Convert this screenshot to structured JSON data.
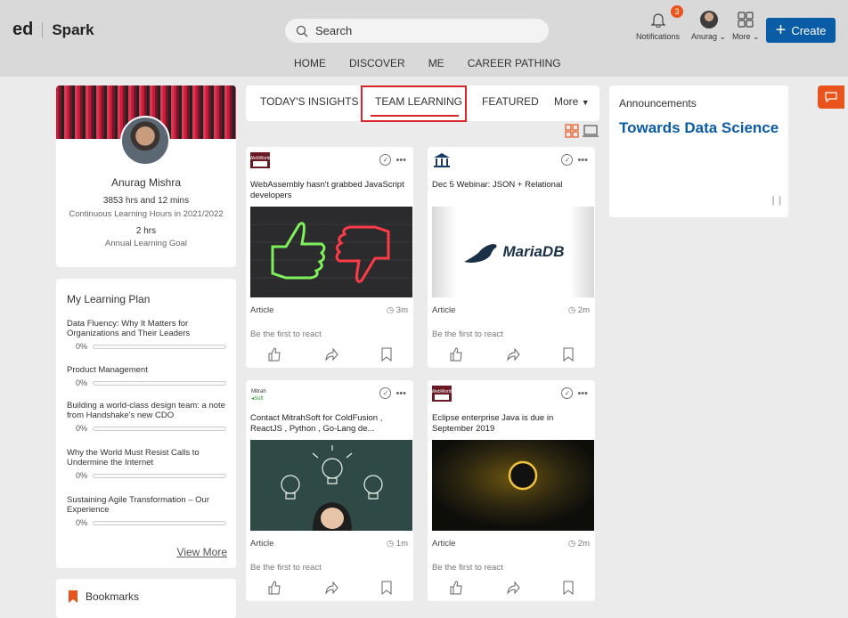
{
  "brand": {
    "logo_ed": "ed",
    "logo_spark": "Spark",
    "accent": "#0b5ca6",
    "highlight": "#d8262c"
  },
  "search": {
    "placeholder": "Search"
  },
  "nav": [
    "HOME",
    "DISCOVER",
    "ME",
    "CAREER PATHING"
  ],
  "header": {
    "notifications_label": "Notifications",
    "notifications_count": "3",
    "user_label": "Anurag",
    "more_label": "More",
    "create_label": "Create"
  },
  "profile": {
    "name": "Anurag Mishra",
    "hours": "3853 hrs and 12 mins",
    "hours_caption": "Continuous Learning Hours in 2021/2022",
    "goal": "2 hrs",
    "goal_caption": "Annual Learning Goal"
  },
  "learning_plan": {
    "title": "My Learning Plan",
    "items": [
      {
        "title": "Data Fluency: Why It Matters for Organizations and Their Leaders",
        "progress": "0%"
      },
      {
        "title": "Product Management",
        "progress": "0%"
      },
      {
        "title": "Building a world-class design team: a note from Handshake's new CDO",
        "progress": "0%"
      },
      {
        "title": "Why the World Must Resist Calls to Undermine the Internet",
        "progress": "0%"
      },
      {
        "title": "Sustaining Agile Transformation – Our Experience",
        "progress": "0%"
      }
    ],
    "view_more": "View More"
  },
  "bookmarks": {
    "title": "Bookmarks"
  },
  "tabs": [
    "TODAY'S INSIGHTS",
    "TEAM LEARNING",
    "FEATURED",
    "More"
  ],
  "cards": [
    {
      "title": "WebAssembly hasn't grabbed JavaScript developers",
      "type": "Article",
      "duration": "3m",
      "react": "Be the first to react",
      "source_icon": "webworld-logo-icon"
    },
    {
      "title": "Dec 5 Webinar: JSON + Relational",
      "type": "Article",
      "duration": "2m",
      "react": "Be the first to react",
      "source_icon": "institution-icon",
      "img_text": "MariaDB"
    },
    {
      "title": "Contact MitrahSoft for ColdFusion , ReactJS , Python , Go-Lang de...",
      "type": "Article",
      "duration": "1m",
      "react": "Be the first to react",
      "source_icon": "mitrahsoft-logo-icon"
    },
    {
      "title": "Eclipse enterprise Java is due in September 2019",
      "type": "Article",
      "duration": "2m",
      "react": "Be the first to react",
      "source_icon": "webworld-logo-icon"
    }
  ],
  "announcements": {
    "label": "Announcements",
    "headline": "Towards Data Science"
  }
}
